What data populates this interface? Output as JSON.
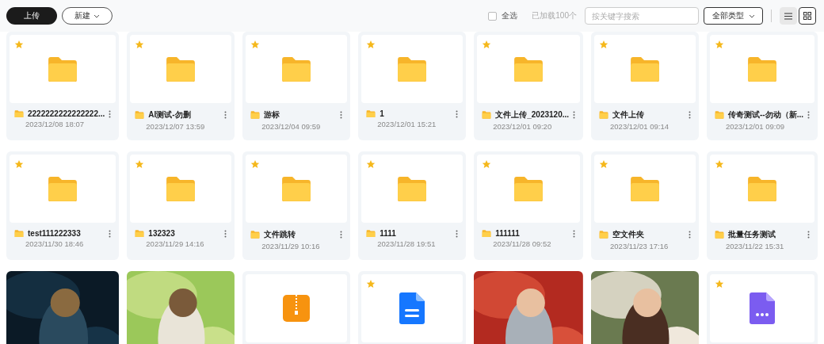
{
  "toolbar": {
    "upload": "上传",
    "new": "新建",
    "select_all": {
      "label": "全选",
      "checked": false
    },
    "loaded": "已加载100个",
    "search": {
      "placeholder": "按关键字搜索"
    },
    "type_filter": "全部类型",
    "views": [
      {
        "kind": "list",
        "selected": false
      },
      {
        "kind": "grid",
        "selected": true
      }
    ]
  },
  "items": [
    {
      "kind": "folder",
      "starred": true,
      "name": "2222222222222222...",
      "date": "2023/12/08 18:07"
    },
    {
      "kind": "folder",
      "starred": true,
      "name": "AI测试-勿删",
      "date": "2023/12/07 13:59"
    },
    {
      "kind": "folder",
      "starred": true,
      "name": "游标",
      "date": "2023/12/04 09:59"
    },
    {
      "kind": "folder",
      "starred": true,
      "name": "1",
      "date": "2023/12/01 15:21"
    },
    {
      "kind": "folder",
      "starred": true,
      "name": "文件上传_2023120...",
      "date": "2023/12/01 09:20"
    },
    {
      "kind": "folder",
      "starred": true,
      "name": "文件上传",
      "date": "2023/12/01 09:14"
    },
    {
      "kind": "folder",
      "starred": true,
      "name": "传奇测试--勿动（新...",
      "date": "2023/12/01 09:09"
    },
    {
      "kind": "folder",
      "starred": true,
      "name": "test111222333",
      "date": "2023/11/30 18:46"
    },
    {
      "kind": "folder",
      "starred": true,
      "name": "132323",
      "date": "2023/11/29 14:16"
    },
    {
      "kind": "folder",
      "starred": true,
      "name": "文件跳转",
      "date": "2023/11/29 10:16"
    },
    {
      "kind": "folder",
      "starred": true,
      "name": "1111",
      "date": "2023/11/28 19:51"
    },
    {
      "kind": "folder",
      "starred": true,
      "name": "111111",
      "date": "2023/11/28 09:52"
    },
    {
      "kind": "folder",
      "starred": true,
      "name": "空文件夹",
      "date": "2023/11/23 17:16"
    },
    {
      "kind": "folder",
      "starred": true,
      "name": "批量任务测试",
      "date": "2023/11/22 15:31"
    },
    {
      "kind": "picture"
    },
    {
      "kind": "picture"
    },
    {
      "kind": "zip",
      "starred": false
    },
    {
      "kind": "doc",
      "starred": true
    },
    {
      "kind": "picture"
    },
    {
      "kind": "picture"
    },
    {
      "kind": "other",
      "starred": true
    }
  ]
}
